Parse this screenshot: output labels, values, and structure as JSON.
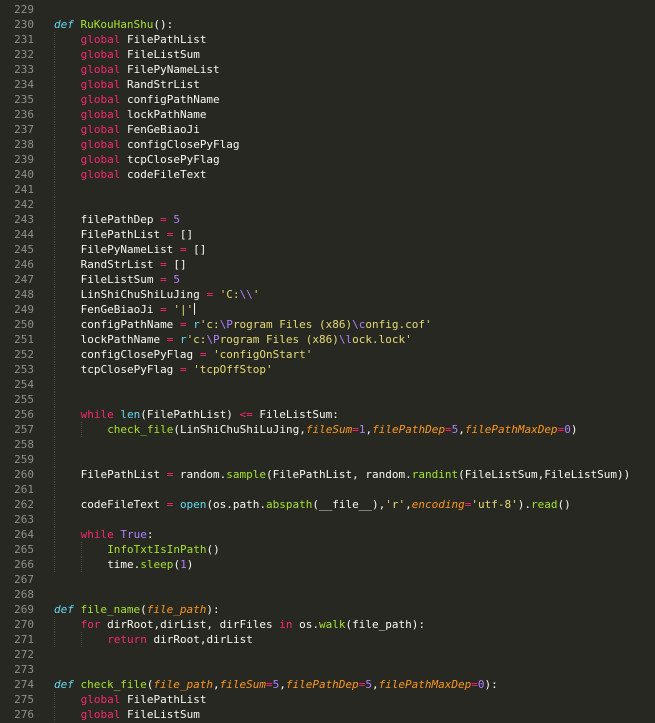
{
  "editor": {
    "language": "python",
    "colors": {
      "background": "#272822",
      "line_number": "#90908a",
      "text": "#f8f8f2",
      "keyword": "#f92672",
      "storage": "#66d9ef",
      "function": "#a6e22e",
      "number": "#ae81ff",
      "string": "#e6db74",
      "parameter": "#fd971f"
    },
    "lines": [
      {
        "n": "229",
        "indent": 0,
        "tokens": []
      },
      {
        "n": "230",
        "indent": 0,
        "tokens": [
          [
            "def",
            "def"
          ],
          [
            "pl",
            " "
          ],
          [
            "fn",
            "RuKouHanShu"
          ],
          [
            "pl",
            "():"
          ]
        ]
      },
      {
        "n": "231",
        "indent": 1,
        "tokens": [
          [
            "kw",
            "global"
          ],
          [
            "pl",
            " FilePathList"
          ]
        ]
      },
      {
        "n": "232",
        "indent": 1,
        "tokens": [
          [
            "kw",
            "global"
          ],
          [
            "pl",
            " FileListSum"
          ]
        ]
      },
      {
        "n": "233",
        "indent": 1,
        "tokens": [
          [
            "kw",
            "global"
          ],
          [
            "pl",
            " FilePyNameList"
          ]
        ]
      },
      {
        "n": "234",
        "indent": 1,
        "tokens": [
          [
            "kw",
            "global"
          ],
          [
            "pl",
            " RandStrList"
          ]
        ]
      },
      {
        "n": "235",
        "indent": 1,
        "tokens": [
          [
            "kw",
            "global"
          ],
          [
            "pl",
            " configPathName"
          ]
        ]
      },
      {
        "n": "236",
        "indent": 1,
        "tokens": [
          [
            "kw",
            "global"
          ],
          [
            "pl",
            " lockPathName"
          ]
        ]
      },
      {
        "n": "237",
        "indent": 1,
        "tokens": [
          [
            "kw",
            "global"
          ],
          [
            "pl",
            " FenGeBiaoJi"
          ]
        ]
      },
      {
        "n": "238",
        "indent": 1,
        "tokens": [
          [
            "kw",
            "global"
          ],
          [
            "pl",
            " configClosePyFlag"
          ]
        ]
      },
      {
        "n": "239",
        "indent": 1,
        "tokens": [
          [
            "kw",
            "global"
          ],
          [
            "pl",
            " tcpClosePyFlag"
          ]
        ]
      },
      {
        "n": "240",
        "indent": 1,
        "tokens": [
          [
            "kw",
            "global"
          ],
          [
            "pl",
            " codeFileText"
          ]
        ]
      },
      {
        "n": "241",
        "indent": 1,
        "tokens": []
      },
      {
        "n": "242",
        "indent": 1,
        "tokens": []
      },
      {
        "n": "243",
        "indent": 1,
        "tokens": [
          [
            "pl",
            "filePathDep "
          ],
          [
            "op",
            "="
          ],
          [
            "pl",
            " "
          ],
          [
            "num",
            "5"
          ]
        ]
      },
      {
        "n": "244",
        "indent": 1,
        "tokens": [
          [
            "pl",
            "FilePathList "
          ],
          [
            "op",
            "="
          ],
          [
            "pl",
            " []"
          ]
        ]
      },
      {
        "n": "245",
        "indent": 1,
        "tokens": [
          [
            "pl",
            "FilePyNameList "
          ],
          [
            "op",
            "="
          ],
          [
            "pl",
            " []"
          ]
        ]
      },
      {
        "n": "246",
        "indent": 1,
        "tokens": [
          [
            "pl",
            "RandStrList "
          ],
          [
            "op",
            "="
          ],
          [
            "pl",
            " []"
          ]
        ]
      },
      {
        "n": "247",
        "indent": 1,
        "tokens": [
          [
            "pl",
            "FileListSum "
          ],
          [
            "op",
            "="
          ],
          [
            "pl",
            " "
          ],
          [
            "num",
            "5"
          ]
        ]
      },
      {
        "n": "248",
        "indent": 1,
        "tokens": [
          [
            "pl",
            "LinShiChuShiLuJing "
          ],
          [
            "op",
            "="
          ],
          [
            "pl",
            " "
          ],
          [
            "str",
            "'C:"
          ],
          [
            "num",
            "\\\\"
          ],
          [
            "str",
            "'"
          ]
        ]
      },
      {
        "n": "249",
        "indent": 1,
        "tokens": [
          [
            "pl",
            "FenGeBiaoJi "
          ],
          [
            "op",
            "="
          ],
          [
            "pl",
            " "
          ],
          [
            "str",
            "'|'"
          ]
        ]
      },
      {
        "n": "250",
        "indent": 1,
        "tokens": [
          [
            "pl",
            "configPathName "
          ],
          [
            "op",
            "="
          ],
          [
            "pl",
            " "
          ],
          [
            "bi",
            "r"
          ],
          [
            "str",
            "'c:"
          ],
          [
            "num",
            "\\P"
          ],
          [
            "str",
            "rogram Files (x86)"
          ],
          [
            "num",
            "\\c"
          ],
          [
            "str",
            "onfig.cof'"
          ]
        ]
      },
      {
        "n": "251",
        "indent": 1,
        "tokens": [
          [
            "pl",
            "lockPathName "
          ],
          [
            "op",
            "="
          ],
          [
            "pl",
            " "
          ],
          [
            "bi",
            "r"
          ],
          [
            "str",
            "'c:"
          ],
          [
            "num",
            "\\P"
          ],
          [
            "str",
            "rogram Files (x86)"
          ],
          [
            "num",
            "\\l"
          ],
          [
            "str",
            "ock.lock'"
          ]
        ]
      },
      {
        "n": "252",
        "indent": 1,
        "tokens": [
          [
            "pl",
            "configClosePyFlag "
          ],
          [
            "op",
            "="
          ],
          [
            "pl",
            " "
          ],
          [
            "str",
            "'configOnStart'"
          ]
        ]
      },
      {
        "n": "253",
        "indent": 1,
        "tokens": [
          [
            "pl",
            "tcpClosePyFlag "
          ],
          [
            "op",
            "="
          ],
          [
            "pl",
            " "
          ],
          [
            "str",
            "'tcpOffStop'"
          ]
        ]
      },
      {
        "n": "254",
        "indent": 1,
        "tokens": []
      },
      {
        "n": "255",
        "indent": 1,
        "tokens": []
      },
      {
        "n": "256",
        "indent": 1,
        "tokens": [
          [
            "kw",
            "while"
          ],
          [
            "pl",
            " "
          ],
          [
            "bi",
            "len"
          ],
          [
            "pl",
            "(FilePathList) "
          ],
          [
            "op",
            "<="
          ],
          [
            "pl",
            " FileListSum:"
          ]
        ]
      },
      {
        "n": "257",
        "indent": 2,
        "tokens": [
          [
            "fn",
            "check_file"
          ],
          [
            "pl",
            "(LinShiChuShiLuJing,"
          ],
          [
            "par",
            "fileSum"
          ],
          [
            "op",
            "="
          ],
          [
            "num",
            "1"
          ],
          [
            "pl",
            ","
          ],
          [
            "par",
            "filePathDep"
          ],
          [
            "op",
            "="
          ],
          [
            "num",
            "5"
          ],
          [
            "pl",
            ","
          ],
          [
            "par",
            "filePathMaxDep"
          ],
          [
            "op",
            "="
          ],
          [
            "num",
            "0"
          ],
          [
            "pl",
            ")"
          ]
        ]
      },
      {
        "n": "258",
        "indent": 1,
        "tokens": []
      },
      {
        "n": "259",
        "indent": 1,
        "tokens": []
      },
      {
        "n": "260",
        "indent": 1,
        "tokens": [
          [
            "pl",
            "FilePathList "
          ],
          [
            "op",
            "="
          ],
          [
            "pl",
            " random."
          ],
          [
            "fn",
            "sample"
          ],
          [
            "pl",
            "(FilePathList, random."
          ],
          [
            "fn",
            "randint"
          ],
          [
            "pl",
            "(FileListSum,FileListSum))"
          ]
        ]
      },
      {
        "n": "261",
        "indent": 1,
        "tokens": []
      },
      {
        "n": "262",
        "indent": 1,
        "tokens": [
          [
            "pl",
            "codeFileText "
          ],
          [
            "op",
            "="
          ],
          [
            "pl",
            " "
          ],
          [
            "bi",
            "open"
          ],
          [
            "pl",
            "(os.path."
          ],
          [
            "fn",
            "abspath"
          ],
          [
            "pl",
            "(__file__),"
          ],
          [
            "str",
            "'r'"
          ],
          [
            "pl",
            ","
          ],
          [
            "par",
            "encoding"
          ],
          [
            "op",
            "="
          ],
          [
            "str",
            "'utf-8'"
          ],
          [
            "pl",
            ")."
          ],
          [
            "fn",
            "read"
          ],
          [
            "pl",
            "()"
          ]
        ]
      },
      {
        "n": "263",
        "indent": 1,
        "tokens": []
      },
      {
        "n": "264",
        "indent": 1,
        "tokens": [
          [
            "kw",
            "while"
          ],
          [
            "pl",
            " "
          ],
          [
            "num",
            "True"
          ],
          [
            "pl",
            ":"
          ]
        ]
      },
      {
        "n": "265",
        "indent": 2,
        "tokens": [
          [
            "fn",
            "InfoTxtIsInPath"
          ],
          [
            "pl",
            "()"
          ]
        ]
      },
      {
        "n": "266",
        "indent": 2,
        "tokens": [
          [
            "pl",
            "time."
          ],
          [
            "fn",
            "sleep"
          ],
          [
            "pl",
            "("
          ],
          [
            "num",
            "1"
          ],
          [
            "pl",
            ")"
          ]
        ]
      },
      {
        "n": "267",
        "indent": 0,
        "tokens": []
      },
      {
        "n": "268",
        "indent": 0,
        "tokens": []
      },
      {
        "n": "269",
        "indent": 0,
        "tokens": [
          [
            "def",
            "def"
          ],
          [
            "pl",
            " "
          ],
          [
            "fn",
            "file_name"
          ],
          [
            "pl",
            "("
          ],
          [
            "par",
            "file_path"
          ],
          [
            "pl",
            "):"
          ]
        ]
      },
      {
        "n": "270",
        "indent": 1,
        "tokens": [
          [
            "kw",
            "for"
          ],
          [
            "pl",
            " dirRoot,dirList, dirFiles "
          ],
          [
            "kw",
            "in"
          ],
          [
            "pl",
            " os."
          ],
          [
            "fn",
            "walk"
          ],
          [
            "pl",
            "(file_path):"
          ]
        ]
      },
      {
        "n": "271",
        "indent": 2,
        "tokens": [
          [
            "kw",
            "return"
          ],
          [
            "pl",
            " dirRoot,dirList"
          ]
        ]
      },
      {
        "n": "272",
        "indent": 0,
        "tokens": []
      },
      {
        "n": "273",
        "indent": 0,
        "tokens": []
      },
      {
        "n": "274",
        "indent": 0,
        "tokens": [
          [
            "def",
            "def"
          ],
          [
            "pl",
            " "
          ],
          [
            "fn",
            "check_file"
          ],
          [
            "pl",
            "("
          ],
          [
            "par",
            "file_path"
          ],
          [
            "pl",
            ","
          ],
          [
            "par",
            "fileSum"
          ],
          [
            "op",
            "="
          ],
          [
            "num",
            "5"
          ],
          [
            "pl",
            ","
          ],
          [
            "par",
            "filePathDep"
          ],
          [
            "op",
            "="
          ],
          [
            "num",
            "5"
          ],
          [
            "pl",
            ","
          ],
          [
            "par",
            "filePathMaxDep"
          ],
          [
            "op",
            "="
          ],
          [
            "num",
            "0"
          ],
          [
            "pl",
            "):"
          ]
        ]
      },
      {
        "n": "275",
        "indent": 1,
        "tokens": [
          [
            "kw",
            "global"
          ],
          [
            "pl",
            " FilePathList"
          ]
        ]
      },
      {
        "n": "276",
        "indent": 1,
        "tokens": [
          [
            "kw",
            "global"
          ],
          [
            "pl",
            " FileListSum"
          ]
        ]
      }
    ]
  }
}
